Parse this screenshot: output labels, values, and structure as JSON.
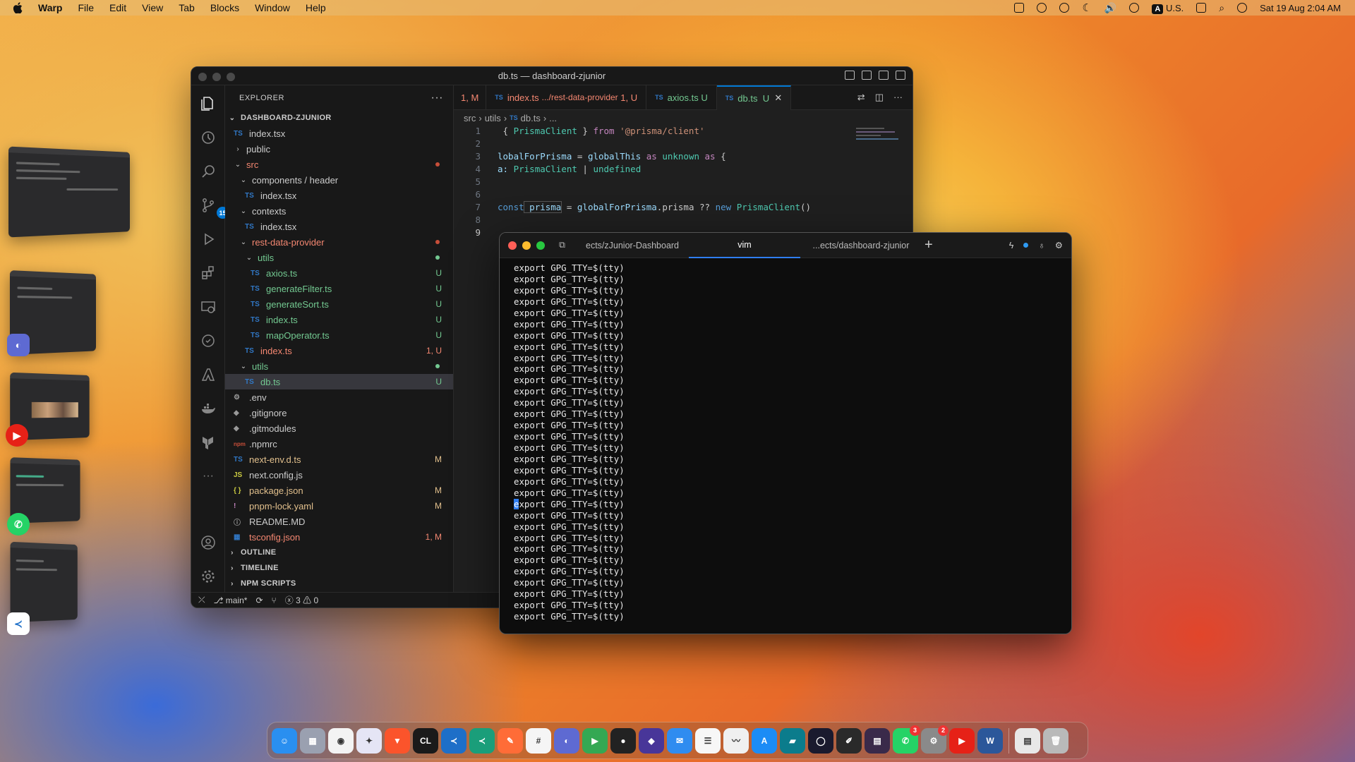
{
  "menubar": {
    "app": "Warp",
    "items": [
      "File",
      "Edit",
      "View",
      "Tab",
      "Blocks",
      "Window",
      "Help"
    ],
    "input_source": "U.S.",
    "input_badge": "A",
    "clock": "Sat 19 Aug  2:04 AM"
  },
  "vscode": {
    "title": "db.ts — dashboard-zjunior",
    "explorer_label": "EXPLORER",
    "explorer_menu": "···",
    "root": "DASHBOARD-ZJUNIOR",
    "source_control_badge": "15",
    "tree": [
      {
        "label": "index.tsx",
        "icon": "TS",
        "indent": 1,
        "color": "#cccccc",
        "status": "",
        "dot": ""
      },
      {
        "label": "public",
        "chev": "›",
        "indent": 1,
        "color": "#cccccc",
        "status": "",
        "dot": ""
      },
      {
        "label": "src",
        "chev": "⌄",
        "indent": 1,
        "color": "#f48771",
        "status": "",
        "dot": "#c74e39"
      },
      {
        "label": "components / header",
        "chev": "⌄",
        "indent": 2,
        "color": "#cccccc",
        "status": "",
        "dot": ""
      },
      {
        "label": "index.tsx",
        "icon": "TS",
        "indent": 3,
        "color": "#cccccc",
        "status": "",
        "dot": ""
      },
      {
        "label": "contexts",
        "chev": "⌄",
        "indent": 2,
        "color": "#cccccc",
        "status": "",
        "dot": ""
      },
      {
        "label": "index.tsx",
        "icon": "TS",
        "indent": 3,
        "color": "#cccccc",
        "status": "",
        "dot": ""
      },
      {
        "label": "rest-data-provider",
        "chev": "⌄",
        "indent": 2,
        "color": "#f48771",
        "status": "",
        "dot": "#c74e39"
      },
      {
        "label": "utils",
        "chev": "⌄",
        "indent": 3,
        "color": "#73c991",
        "status": "",
        "dot": "#73c991"
      },
      {
        "label": "axios.ts",
        "icon": "TS",
        "indent": 4,
        "color": "#73c991",
        "status": "U",
        "dot": ""
      },
      {
        "label": "generateFilter.ts",
        "icon": "TS",
        "indent": 4,
        "color": "#73c991",
        "status": "U",
        "dot": ""
      },
      {
        "label": "generateSort.ts",
        "icon": "TS",
        "indent": 4,
        "color": "#73c991",
        "status": "U",
        "dot": ""
      },
      {
        "label": "index.ts",
        "icon": "TS",
        "indent": 4,
        "color": "#73c991",
        "status": "U",
        "dot": ""
      },
      {
        "label": "mapOperator.ts",
        "icon": "TS",
        "indent": 4,
        "color": "#73c991",
        "status": "U",
        "dot": ""
      },
      {
        "label": "index.ts",
        "icon": "TS",
        "indent": 3,
        "color": "#f48771",
        "status": "1, U",
        "dot": ""
      },
      {
        "label": "utils",
        "chev": "⌄",
        "indent": 2,
        "color": "#73c991",
        "status": "",
        "dot": "#73c991"
      },
      {
        "label": "db.ts",
        "icon": "TS",
        "indent": 3,
        "color": "#73c991",
        "status": "U",
        "dot": "",
        "selected": true
      },
      {
        "label": ".env",
        "icon": "⚙",
        "indent": 1,
        "color": "#cccccc",
        "status": "",
        "dot": ""
      },
      {
        "label": ".gitignore",
        "icon": "◆",
        "indent": 1,
        "color": "#cccccc",
        "status": "",
        "dot": ""
      },
      {
        "label": ".gitmodules",
        "icon": "◆",
        "indent": 1,
        "color": "#cccccc",
        "status": "",
        "dot": ""
      },
      {
        "label": ".npmrc",
        "icon": "npm",
        "indent": 1,
        "color": "#cccccc",
        "status": "",
        "dot": ""
      },
      {
        "label": "next-env.d.ts",
        "icon": "TS",
        "indent": 1,
        "color": "#e2c08d",
        "status": "M",
        "dot": ""
      },
      {
        "label": "next.config.js",
        "icon": "JS",
        "indent": 1,
        "color": "#cccccc",
        "status": "",
        "dot": ""
      },
      {
        "label": "package.json",
        "icon": "{ }",
        "indent": 1,
        "color": "#e2c08d",
        "status": "M",
        "dot": ""
      },
      {
        "label": "pnpm-lock.yaml",
        "icon": "!",
        "indent": 1,
        "color": "#e2c08d",
        "status": "M",
        "dot": ""
      },
      {
        "label": "README.MD",
        "icon": "ⓘ",
        "indent": 1,
        "color": "#cccccc",
        "status": "",
        "dot": ""
      },
      {
        "label": "tsconfig.json",
        "icon": "▦",
        "indent": 1,
        "color": "#f48771",
        "status": "1, M",
        "dot": ""
      }
    ],
    "sections": [
      "OUTLINE",
      "TIMELINE",
      "NPM SCRIPTS"
    ],
    "tabs": [
      {
        "label": "1, M",
        "sub": "",
        "status": ""
      },
      {
        "label": "index.ts",
        "sub": ".../rest-data-provider",
        "status": "1, U"
      },
      {
        "label": "axios.ts",
        "sub": "",
        "status": "U"
      },
      {
        "label": "db.ts",
        "sub": "",
        "status": "U"
      }
    ],
    "breadcrumb": [
      "src",
      "utils",
      "db.ts",
      "..."
    ],
    "line_numbers": [
      "1",
      "2",
      "3",
      "4",
      "5",
      "6",
      "7",
      "8",
      "9"
    ],
    "code": {
      "l1_a": " { ",
      "l1_b": "PrismaClient",
      "l1_c": " } ",
      "l1_d": "from",
      "l1_e": " '@prisma/client'",
      "l3_a": "lobalForPrisma",
      "l3_b": " = ",
      "l3_c": "globalThis",
      "l3_d": " as ",
      "l3_e": "unknown",
      "l3_f": " as ",
      "l3_g": "{",
      "l4_a": "a:",
      "l4_b": " PrismaClient",
      "l4_c": " | ",
      "l4_d": "undefined",
      "l7_a": "const",
      "l7_b": " prisma",
      "l7_c": " = ",
      "l7_d": "globalForPrisma",
      "l7_e": ".prisma ?? ",
      "l7_f": "new",
      "l7_g": " PrismaClient",
      "l7_h": "()"
    },
    "status": {
      "branch": "main*",
      "errors": "3",
      "warnings": "0"
    }
  },
  "warp": {
    "tabs": [
      "ects/zJunior-Dashboard",
      "vim",
      "...ects/dashboard-zjunior"
    ],
    "new_tab": "+",
    "line_text": "export GPG_TTY=$(tty)",
    "cursor_char": "e",
    "cursor_rest": "xport GPG_TTY=$(tty)",
    "line_count": 32,
    "cursor_line": 21
  },
  "dock": {
    "apps": [
      {
        "name": "finder-icon",
        "bg": "#2a8ff0",
        "label": "☺"
      },
      {
        "name": "launchpad-icon",
        "bg": "#9aa0b0",
        "label": "▦"
      },
      {
        "name": "chrome-icon",
        "bg": "#f3f3f3",
        "label": "◉"
      },
      {
        "name": "app-icon",
        "bg": "#e5e5f5",
        "label": "✦"
      },
      {
        "name": "brave-icon",
        "bg": "#fb542b",
        "label": "▼"
      },
      {
        "name": "clion-icon",
        "bg": "#1a1a1a",
        "label": "CL"
      },
      {
        "name": "vscode-icon",
        "bg": "#1e6fc8",
        "label": "≺"
      },
      {
        "name": "vscode-insiders-icon",
        "bg": "#1a9e7a",
        "label": "≺"
      },
      {
        "name": "postman-icon",
        "bg": "#ff6c37",
        "label": "✎"
      },
      {
        "name": "slack-icon",
        "bg": "#f5f5f5",
        "label": "#"
      },
      {
        "name": "linear-icon",
        "bg": "#5e6ad2",
        "label": "◐"
      },
      {
        "name": "meet-icon",
        "bg": "#34a853",
        "label": "▶"
      },
      {
        "name": "app-icon",
        "bg": "#222",
        "label": "●"
      },
      {
        "name": "obsidian-icon",
        "bg": "#483699",
        "label": "◆"
      },
      {
        "name": "mail-icon",
        "bg": "#2f8cf0",
        "label": "✉"
      },
      {
        "name": "reminders-icon",
        "bg": "#f7f7f7",
        "label": "☰"
      },
      {
        "name": "activity-monitor-icon",
        "bg": "#f0f0f0",
        "label": "〰"
      },
      {
        "name": "app-store-icon",
        "bg": "#1c8cf6",
        "label": "A"
      },
      {
        "name": "app-icon",
        "bg": "#0b7c8c",
        "label": "▰"
      },
      {
        "name": "app-icon",
        "bg": "#1a1a2e",
        "label": "◯"
      },
      {
        "name": "app-icon",
        "bg": "#2a2a2a",
        "label": "✐"
      },
      {
        "name": "app-icon",
        "bg": "#3a2a4a",
        "label": "▤"
      },
      {
        "name": "whatsapp-icon",
        "bg": "#25d366",
        "label": "✆",
        "badge": "3"
      },
      {
        "name": "system-settings-icon",
        "bg": "#8a8a8a",
        "label": "⚙",
        "badge": "2"
      },
      {
        "name": "youtube-music-icon",
        "bg": "#e62117",
        "label": "▶"
      },
      {
        "name": "word-icon",
        "bg": "#2b579a",
        "label": "W"
      }
    ],
    "trailing": [
      {
        "name": "document-icon",
        "bg": "#e8e8e8",
        "label": "▤"
      },
      {
        "name": "trash-icon",
        "bg": "#b9b9b9",
        "label": "🗑"
      }
    ]
  }
}
